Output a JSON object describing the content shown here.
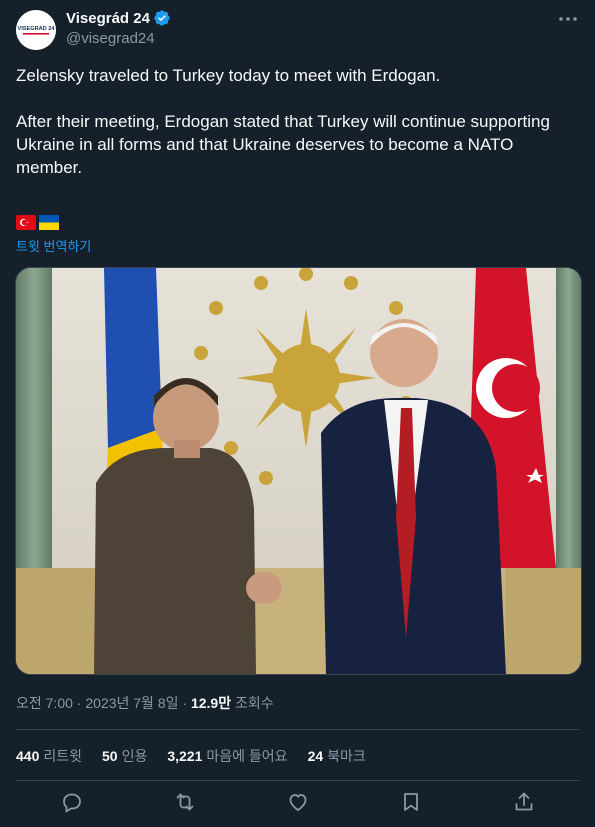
{
  "account": {
    "display_name": "Visegrád 24",
    "handle": "@visegrad24",
    "avatar_text": "VISEGRAD 24"
  },
  "tweet": {
    "paragraph1": "Zelensky traveled to Turkey today to meet with Erdogan.",
    "paragraph2": "After their meeting, Erdogan stated that Turkey will continue supporting Ukraine in all forms and that Ukraine deserves to become a NATO member.",
    "flags": [
      "turkey-flag",
      "ukraine-flag"
    ],
    "translate_label": "트윗 번역하기"
  },
  "meta": {
    "time": "오전 7:00",
    "separator": " · ",
    "date": "2023년 7월 8일",
    "views_count": "12.9만",
    "views_label": " 조회수"
  },
  "stats": [
    {
      "count": "440",
      "label": "리트윗"
    },
    {
      "count": "50",
      "label": "인용"
    },
    {
      "count": "3,221",
      "label": "마음에 들어요"
    },
    {
      "count": "24",
      "label": "북마크"
    }
  ],
  "actions": [
    "reply-icon",
    "retweet-icon",
    "like-icon",
    "bookmark-icon",
    "share-icon"
  ],
  "colors": {
    "background": "#15202b",
    "text": "#f7f9f9",
    "muted": "#8b98a5",
    "accent": "#1d9bf0",
    "border": "#38444d"
  }
}
